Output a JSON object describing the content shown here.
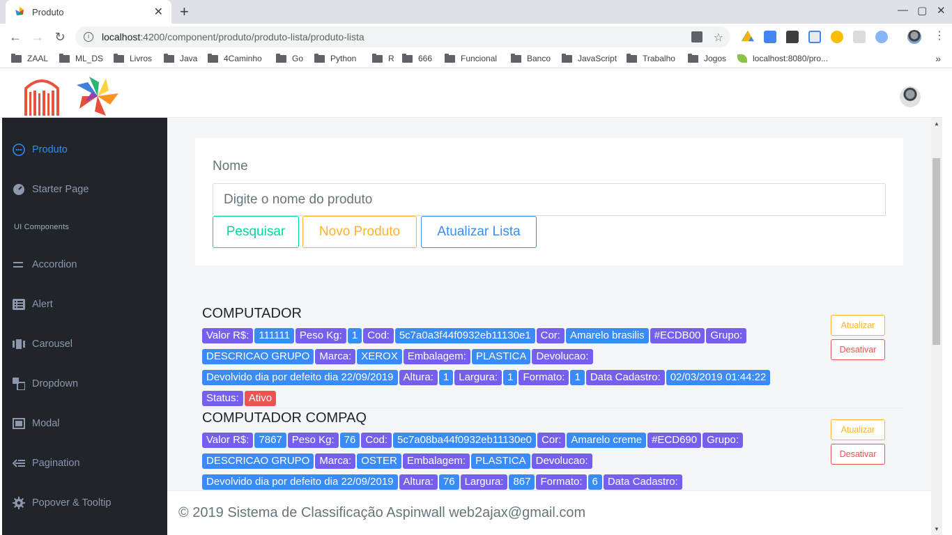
{
  "browser": {
    "tab_title": "Produto",
    "tab_close": "✕",
    "new_tab": "+",
    "window_minimize": "—",
    "window_maximize": "▢",
    "window_close": "✕",
    "url_host": "localhost",
    "url_path": ":4200/component/produto/produto-lista/produto-lista",
    "bookmarks": [
      {
        "label": "ZAAL",
        "icon": "folder-icon"
      },
      {
        "label": "ML_DS",
        "icon": "folder-icon"
      },
      {
        "label": "Livros",
        "icon": "folder-icon"
      },
      {
        "label": "Java",
        "icon": "folder-icon"
      },
      {
        "label": "4Caminho",
        "icon": "folder-icon"
      },
      {
        "label": "Go",
        "icon": "folder-icon"
      },
      {
        "label": "Python",
        "icon": "folder-icon"
      },
      {
        "label": "R",
        "icon": "folder-icon"
      },
      {
        "label": "666",
        "icon": "folder-icon"
      },
      {
        "label": "Funcional",
        "icon": "folder-icon"
      },
      {
        "label": "Banco",
        "icon": "folder-icon"
      },
      {
        "label": "JavaScript",
        "icon": "folder-icon"
      },
      {
        "label": "Trabalho",
        "icon": "folder-icon"
      },
      {
        "label": "Jogos",
        "icon": "folder-icon"
      },
      {
        "label": "localhost:8080/pro...",
        "icon": "leaf-icon"
      }
    ],
    "bookmarks_more": "»"
  },
  "sidebar": {
    "items": [
      {
        "label": "Produto",
        "icon": "circle-dots-icon",
        "active": true
      },
      {
        "label": "Starter Page",
        "icon": "gauge-icon"
      },
      {
        "label": "Accordion",
        "icon": "equal-icon"
      },
      {
        "label": "Alert",
        "icon": "list-alert-icon"
      },
      {
        "label": "Carousel",
        "icon": "carousel-icon"
      },
      {
        "label": "Dropdown",
        "icon": "dropdown-icon"
      },
      {
        "label": "Modal",
        "icon": "modal-icon"
      },
      {
        "label": "Pagination",
        "icon": "pagination-icon"
      },
      {
        "label": "Popover & Tooltip",
        "icon": "gear-icon"
      }
    ],
    "section_label": "UI Components"
  },
  "search_card": {
    "label": "Nome",
    "placeholder": "Digite o nome do produto",
    "btn_search": "Pesquisar",
    "btn_new": "Novo Produto",
    "btn_refresh": "Atualizar Lista"
  },
  "products": [
    {
      "name": "COMPUTADOR",
      "rows": [
        [
          [
            "p",
            "Valor R$:"
          ],
          [
            "b",
            "111111"
          ],
          [
            "p",
            "Peso Kg:"
          ],
          [
            "b",
            "1"
          ],
          [
            "p",
            "Cod:"
          ],
          [
            "b",
            "5c7a0a3f44f0932eb11130e1"
          ],
          [
            "p",
            "Cor:"
          ],
          [
            "b",
            "Amarelo brasilis"
          ],
          [
            "p",
            "#ECDB00"
          ],
          [
            "p",
            "Grupo:"
          ]
        ],
        [
          [
            "b",
            "DESCRICAO GRUPO"
          ],
          [
            "p",
            "Marca:"
          ],
          [
            "b",
            "XEROX"
          ],
          [
            "p",
            "Embalagem:"
          ],
          [
            "b",
            "PLASTICA"
          ],
          [
            "p",
            "Devolucao:"
          ]
        ],
        [
          [
            "b",
            "Devolvido dia por defeito dia 22/09/2019"
          ],
          [
            "p",
            "Altura:"
          ],
          [
            "b",
            "1"
          ],
          [
            "p",
            "Largura:"
          ],
          [
            "b",
            "1"
          ],
          [
            "p",
            "Formato:"
          ],
          [
            "b",
            "1"
          ],
          [
            "p",
            "Data Cadastro:"
          ],
          [
            "b",
            "02/03/2019 01:44:22"
          ]
        ],
        [
          [
            "p",
            "Status:"
          ],
          [
            "r",
            "Ativo"
          ]
        ]
      ],
      "btn_update": "Atualizar",
      "btn_disable": "Desativar"
    },
    {
      "name": "COMPUTADOR COMPAQ",
      "rows": [
        [
          [
            "p",
            "Valor R$:"
          ],
          [
            "b",
            "7867"
          ],
          [
            "p",
            "Peso Kg:"
          ],
          [
            "b",
            "76"
          ],
          [
            "p",
            "Cod:"
          ],
          [
            "b",
            "5c7a08ba44f0932eb11130e0"
          ],
          [
            "p",
            "Cor:"
          ],
          [
            "b",
            "Amarelo creme"
          ],
          [
            "p",
            "#ECD690"
          ],
          [
            "p",
            "Grupo:"
          ]
        ],
        [
          [
            "b",
            "DESCRICAO GRUPO"
          ],
          [
            "p",
            "Marca:"
          ],
          [
            "b",
            "OSTER"
          ],
          [
            "p",
            "Embalagem:"
          ],
          [
            "b",
            "PLASTICA"
          ],
          [
            "p",
            "Devolucao:"
          ]
        ],
        [
          [
            "b",
            "Devolvido dia por defeito dia 22/09/2019"
          ],
          [
            "p",
            "Altura:"
          ],
          [
            "b",
            "76"
          ],
          [
            "p",
            "Largura:"
          ],
          [
            "b",
            "867"
          ],
          [
            "p",
            "Formato:"
          ],
          [
            "b",
            "6"
          ],
          [
            "p",
            "Data Cadastro:"
          ]
        ]
      ],
      "btn_update": "Atualizar",
      "btn_disable": "Desativar"
    }
  ],
  "footer": {
    "text": "© 2019 Sistema de Classificação Aspinwall web2ajax@gmail.com"
  },
  "colors": {
    "sidebar_bg": "#212529",
    "active": "#2f8bf5",
    "tag_purple": "#7460ee",
    "tag_blue": "#398bf7",
    "tag_red": "#ef5350",
    "btn_green": "#06d79c",
    "btn_orange": "#ffb22b"
  }
}
